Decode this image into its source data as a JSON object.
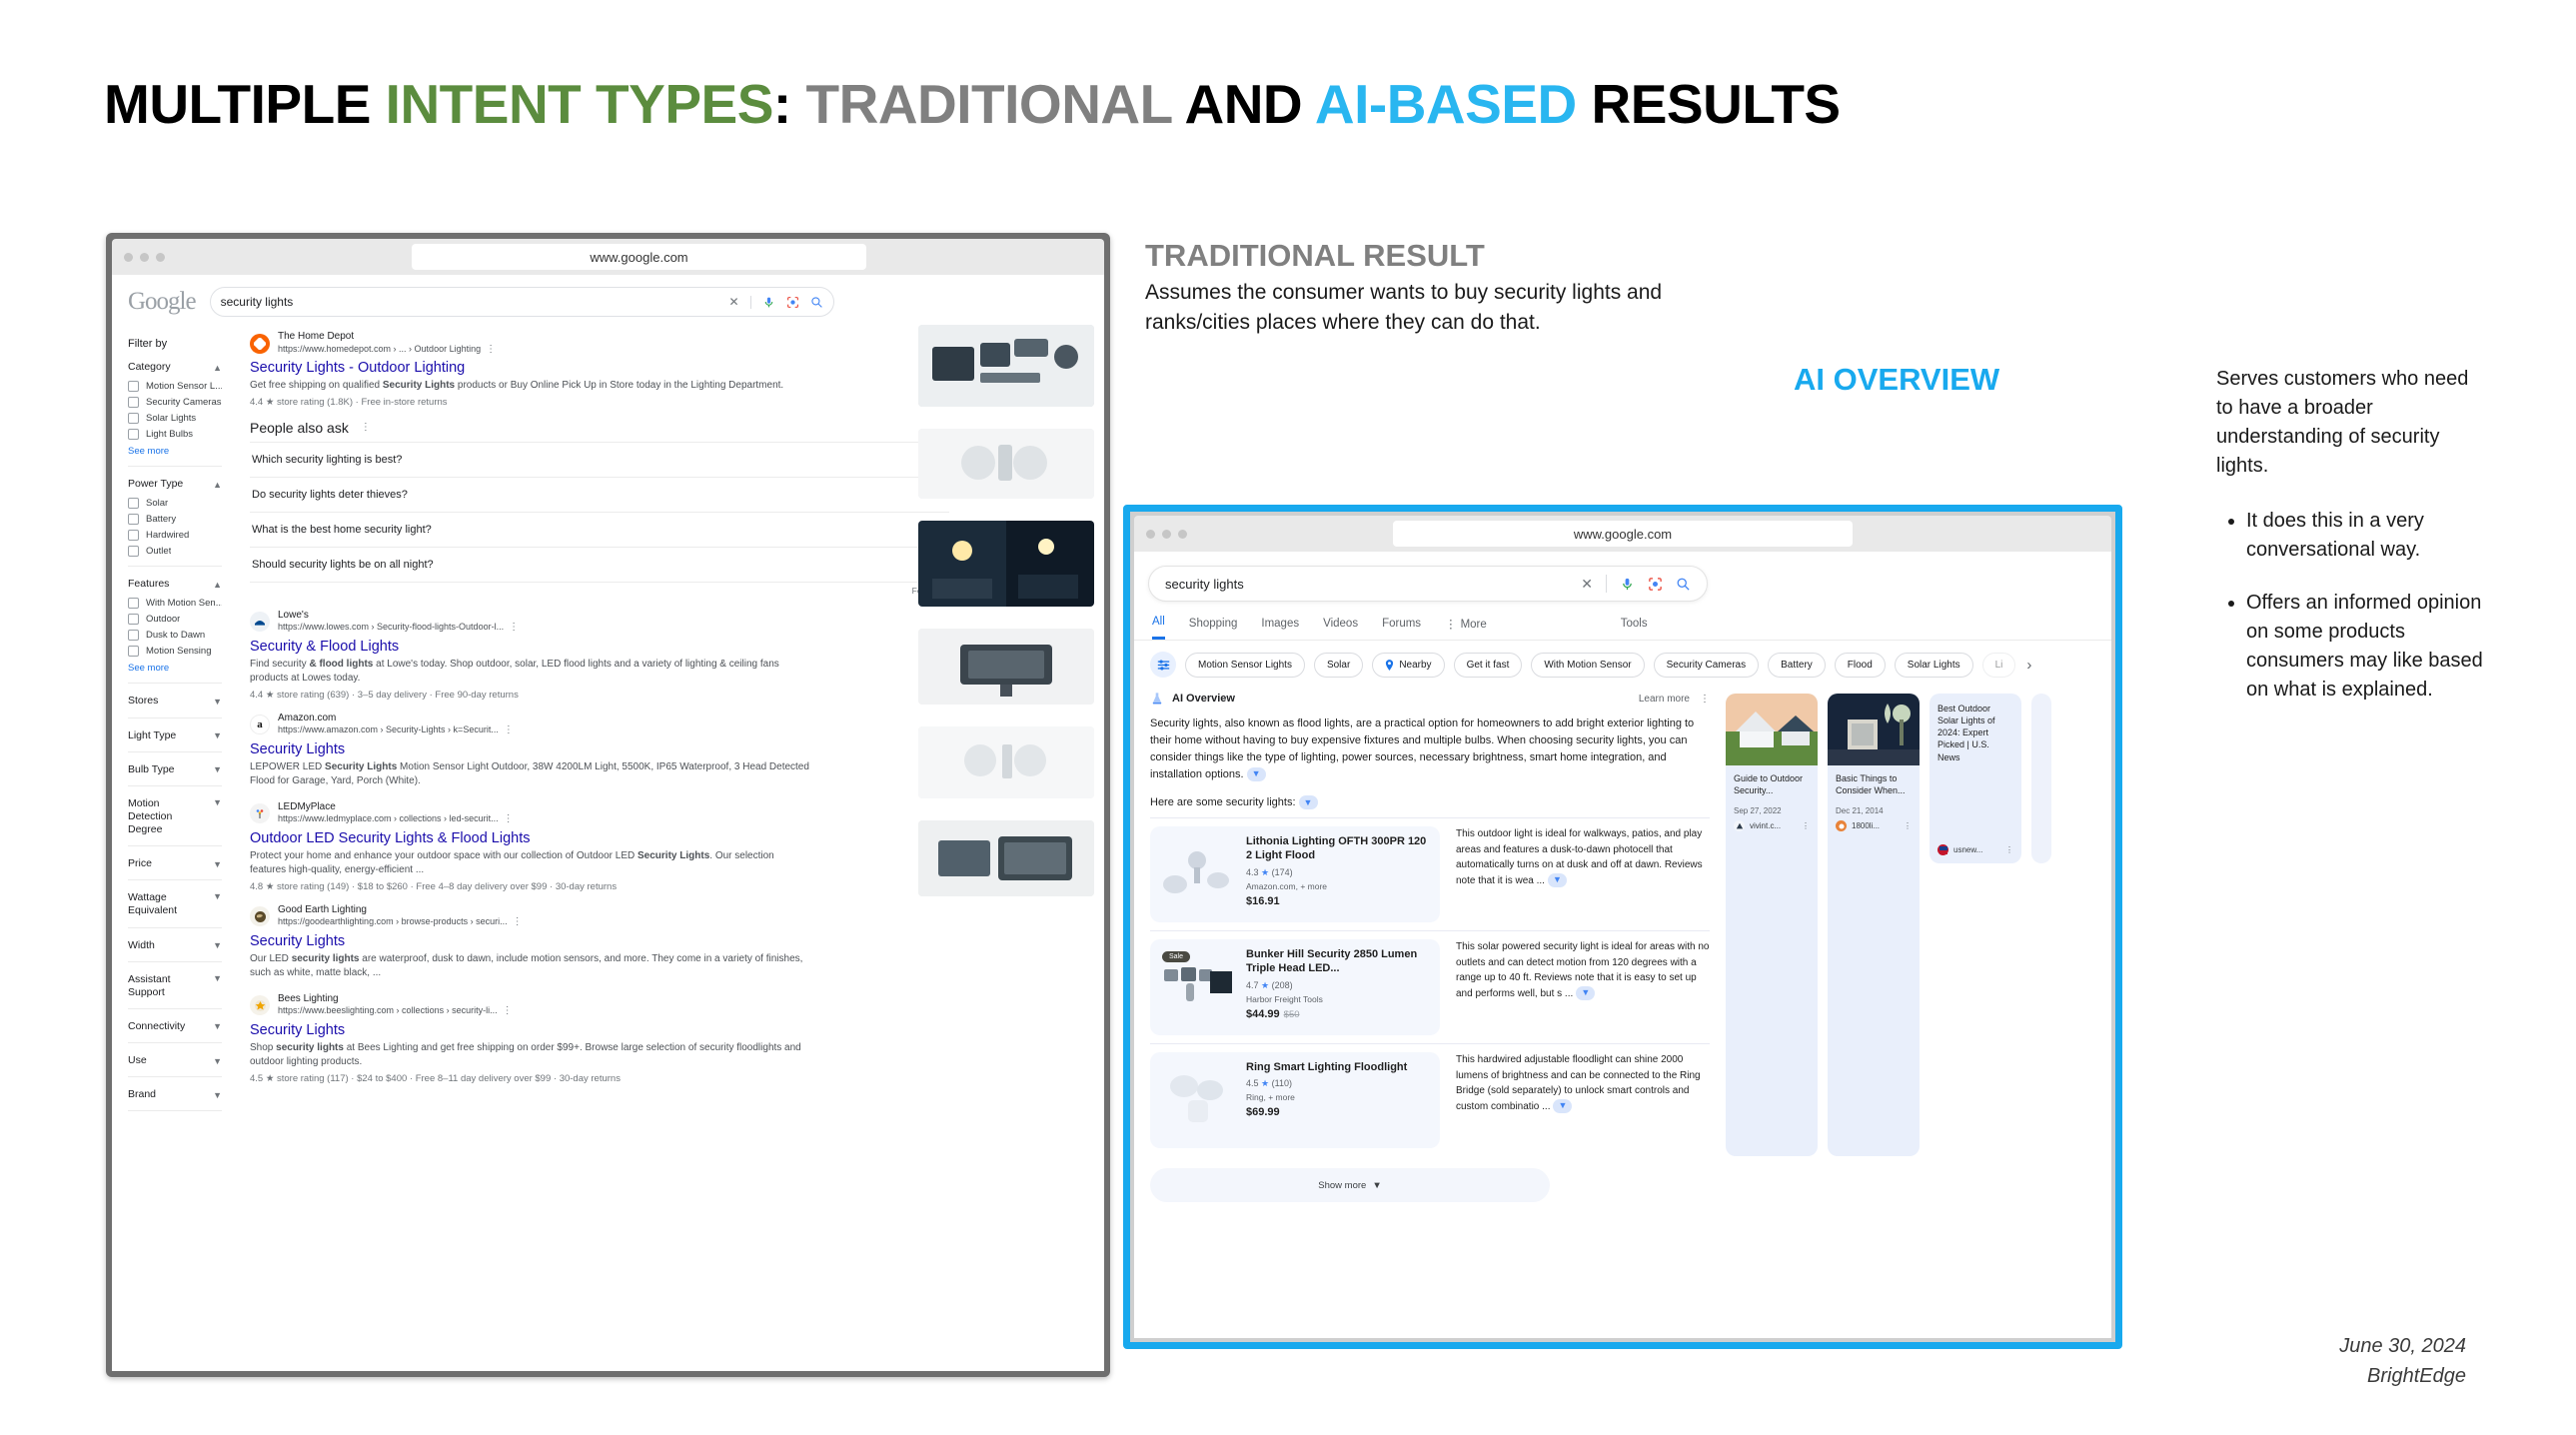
{
  "title": {
    "part1": "MULTIPLE ",
    "part2": "INTENT TYPES",
    "part3": ": ",
    "part4": "TRADITIONAL ",
    "part5": "AND ",
    "part6": "AI-BASED ",
    "part7": "RESULTS"
  },
  "colors": {
    "green": "#5b8c3e",
    "gray": "#808080",
    "cyan": "#18a9ee",
    "link": "#1a0dab"
  },
  "left_window": {
    "url": "www.google.com",
    "logo": "Google",
    "search_value": "security lights",
    "filters": {
      "heading": "Filter by",
      "groups": [
        {
          "label": "Category",
          "expanded": true,
          "items": [
            "Motion Sensor L...",
            "Security Cameras",
            "Solar Lights",
            "Light Bulbs"
          ],
          "see_more": "See more"
        },
        {
          "label": "Power Type",
          "expanded": true,
          "items": [
            "Solar",
            "Battery",
            "Hardwired",
            "Outlet"
          ]
        },
        {
          "label": "Features",
          "expanded": true,
          "items": [
            "With Motion Sen...",
            "Outdoor",
            "Dusk to Dawn",
            "Motion Sensing"
          ],
          "see_more": "See more"
        },
        {
          "label": "Stores",
          "expanded": false
        },
        {
          "label": "Light Type",
          "expanded": false
        },
        {
          "label": "Bulb Type",
          "expanded": false
        },
        {
          "label": "Motion Detection Degree",
          "expanded": false
        },
        {
          "label": "Price",
          "expanded": false
        },
        {
          "label": "Wattage Equivalent",
          "expanded": false
        },
        {
          "label": "Width",
          "expanded": false
        },
        {
          "label": "Assistant Support",
          "expanded": false
        },
        {
          "label": "Connectivity",
          "expanded": false
        },
        {
          "label": "Use",
          "expanded": false
        },
        {
          "label": "Brand",
          "expanded": false
        }
      ]
    },
    "results": [
      {
        "site": "The Home Depot",
        "url": "https://www.homedepot.com › ... › Outdoor Lighting",
        "title": "Security Lights - Outdoor Lighting",
        "snippet_a": "Get free shipping on qualified ",
        "snippet_b": "Security Lights",
        "snippet_c": " products or Buy Online Pick Up in Store today in the Lighting Department.",
        "meta": "4.4 ★ store rating (1.8K) · Free in-store returns"
      },
      {
        "site": "Lowe's",
        "url": "https://www.lowes.com › Security-flood-lights-Outdoor-l...",
        "title": "Security & Flood Lights",
        "snippet_a": "Find security ",
        "snippet_b": "& flood lights",
        "snippet_c": " at Lowe's today. Shop outdoor, solar, LED flood lights and a variety of lighting & ceiling fans products at Lowes today.",
        "meta": "4.4 ★ store rating (639) · 3–5 day delivery · Free 90-day returns"
      },
      {
        "site": "Amazon.com",
        "url": "https://www.amazon.com › Security-Lights › k=Securit...",
        "title": "Security Lights",
        "snippet_a": "LEPOWER LED ",
        "snippet_b": "Security Lights",
        "snippet_c": " Motion Sensor Light Outdoor, 38W 4200LM Light, 5500K, IP65 Waterproof, 3 Head Detected Flood for Garage, Yard, Porch (White).",
        "meta": ""
      },
      {
        "site": "LEDMyPlace",
        "url": "https://www.ledmyplace.com › collections › led-securit...",
        "title": "Outdoor LED Security Lights & Flood Lights",
        "snippet_a": "Protect your home and enhance your outdoor space with our collection of Outdoor LED ",
        "snippet_b": "Security Lights",
        "snippet_c": ". Our selection features high-quality, energy-efficient ...",
        "meta": "4.8 ★ store rating (149) · $18 to $260 · Free 4–8 day delivery over $99 · 30-day returns"
      },
      {
        "site": "Good Earth Lighting",
        "url": "https://goodearthlighting.com › browse-products › securi...",
        "title": "Security Lights",
        "snippet_a": "Our LED ",
        "snippet_b": "security lights",
        "snippet_c": " are waterproof, dusk to dawn, include motion sensors, and more. They come in a variety of finishes, such as white, matte black, ...",
        "meta": ""
      },
      {
        "site": "Bees Lighting",
        "url": "https://www.beeslighting.com › collections › security-li...",
        "title": "Security Lights",
        "snippet_a": "Shop ",
        "snippet_b": "security lights",
        "snippet_c": " at Bees Lighting and get free shipping on order $99+. Browse large selection of security floodlights and outdoor lighting products.",
        "meta": "4.5 ★ store rating (117) · $24 to $400 · Free 8–11 day delivery over $99 · 30-day returns"
      }
    ],
    "people_also_ask": {
      "heading": "People also ask",
      "questions": [
        "Which security lighting is best?",
        "Do security lights deter thieves?",
        "What is the best home security light?",
        "Should security lights be on all night?"
      ],
      "feedback": "Feedback"
    }
  },
  "ai_window": {
    "url": "www.google.com",
    "search_value": "security lights",
    "tabs": [
      "All",
      "Shopping",
      "Images",
      "Videos",
      "Forums",
      "More"
    ],
    "tools_label": "Tools",
    "chips": [
      "Motion Sensor Lights",
      "Solar",
      "Nearby",
      "Get it fast",
      "With Motion Sensor",
      "Security Cameras",
      "Battery",
      "Flood",
      "Solar Lights",
      "Li"
    ],
    "overview": {
      "label": "AI Overview",
      "learn_more": "Learn more",
      "paragraph": "Security lights, also known as flood lights, are a practical option for homeowners to add bright exterior lighting to their home without having to buy expensive fixtures and multiple bulbs. When choosing security lights, you can consider things like the type of lighting, power sources, necessary brightness, smart home integration, and installation options.",
      "subheading": "Here are some security lights:"
    },
    "products": [
      {
        "name": "Lithonia Lighting OFTH 300PR 120 2 Light Flood",
        "rating": "4.3",
        "reviews": "(174)",
        "store": "Amazon.com, + more",
        "price": "$16.91",
        "old_price": "",
        "badge": "",
        "description": "This outdoor light is ideal for walkways, patios, and play areas and features a dusk-to-dawn photocell that automatically turns on at dusk and off at dawn. Reviews note that it is wea ..."
      },
      {
        "name": "Bunker Hill Security 2850 Lumen Triple Head LED...",
        "rating": "4.7",
        "reviews": "(208)",
        "store": "Harbor Freight Tools",
        "price": "$44.99",
        "old_price": "$50",
        "badge": "Sale",
        "description": "This solar powered security light is ideal for areas with no outlets and can detect motion from 120 degrees with a range up to 40 ft. Reviews note that it is easy to set up and performs well, but s ..."
      },
      {
        "name": "Ring Smart Lighting Floodlight",
        "rating": "4.5",
        "reviews": "(110)",
        "store": "Ring, + more",
        "price": "$69.99",
        "old_price": "",
        "badge": "",
        "description": "This hardwired adjustable floodlight can shine 2000 lumens of brightness and can be connected to the Ring Bridge (sold separately) to unlock smart controls and custom combinatio ..."
      }
    ],
    "sources": [
      {
        "title": "Guide to Outdoor Security...",
        "date": "Sep 27, 2022",
        "domain": "vivint.c...",
        "has_image": true
      },
      {
        "title": "Basic Things to Consider When...",
        "date": "Dec 21, 2014",
        "domain": "1800li...",
        "has_image": true
      },
      {
        "title": "Best Outdoor Solar Lights of 2024: Expert Picked | U.S. News",
        "date": "",
        "domain": "usnew...",
        "has_image": false
      }
    ],
    "show_more": "Show more"
  },
  "annotations": {
    "traditional_heading": "TRADITIONAL RESULT",
    "traditional_body": "Assumes the consumer wants to buy security lights and ranks/cities places where they can do that.",
    "ai_heading": "AI OVERVIEW",
    "right_intro": "Serves customers who need to have a broader understanding of security lights.",
    "bullets": [
      "It does this in a very conversational way.",
      "Offers an informed opinion on some products consumers may like based on what is explained."
    ]
  },
  "footer": {
    "date": "June 30, 2024",
    "brand": "BrightEdge"
  }
}
